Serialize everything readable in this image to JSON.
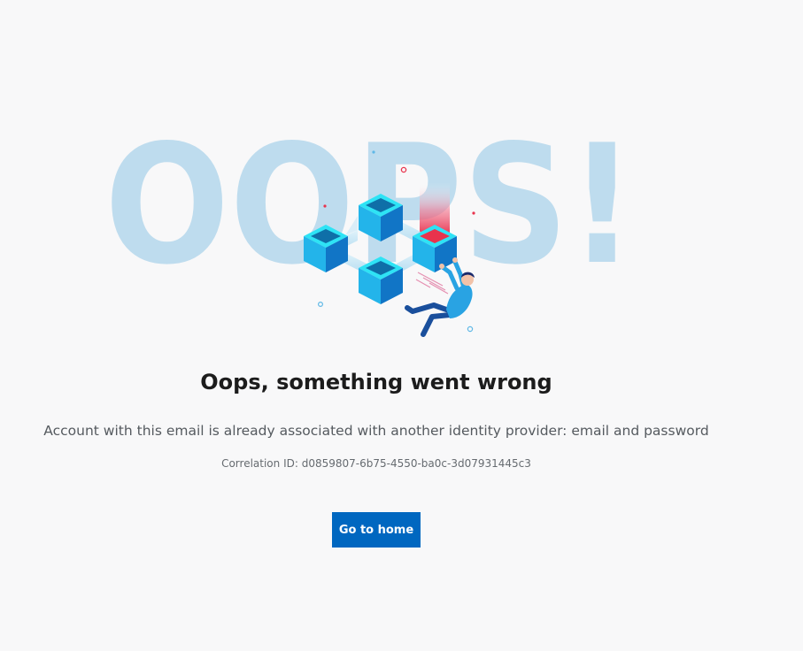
{
  "illustration": {
    "backdrop_text": "OOPS!",
    "backdrop_color": "#bedcee",
    "accent_color": "#e8334d",
    "cube_color": "#1f9fe0"
  },
  "error": {
    "title": "Oops, something went wrong",
    "message": "Account with this email is already associated with another identity provider: email and password",
    "correlation_id": "Correlation ID: d0859807-6b75-4550-ba0c-3d07931445c3"
  },
  "actions": {
    "home_label": "Go to home"
  },
  "colors": {
    "background": "#f8f8f9",
    "primary_button": "#0067c0"
  }
}
